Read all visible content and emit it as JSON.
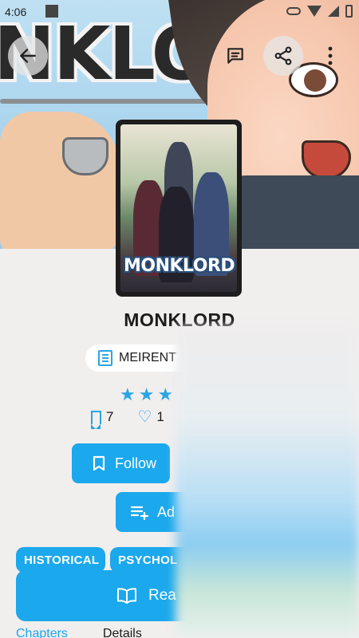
{
  "status_bar": {
    "time": "4:06"
  },
  "hero": {
    "banner_text": "NKLORD"
  },
  "cover": {
    "title": "MONKLORD"
  },
  "manga": {
    "title": "MONKLORD",
    "author": "MEIRENT",
    "rating_stars": 3,
    "bookmarks": "7",
    "likes": "1"
  },
  "actions": {
    "follow_label": "Follow",
    "add_label": "Ad",
    "read_label": "Rea"
  },
  "tags": [
    "HISTORICAL",
    "PSYCHOL"
  ],
  "tabs": [
    "Chapters",
    "Details"
  ],
  "colors": {
    "accent": "#1ba8ec",
    "background": "#f1eeee"
  }
}
